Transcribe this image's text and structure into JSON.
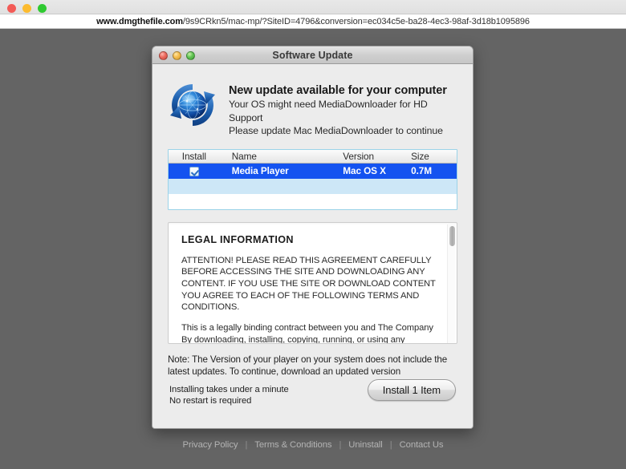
{
  "browser": {
    "traffic_lights": [
      {
        "name": "close",
        "color": "#f35b57"
      },
      {
        "name": "minimize",
        "color": "#fcbb2f"
      },
      {
        "name": "zoom",
        "color": "#2fc931"
      }
    ],
    "url_domain": "www.dmgthefile.com",
    "url_path": "/9s9CRkn5/mac-mp/?SiteID=4796&conversion=ec034c5e-ba28-4ec3-98af-3d18b1095896",
    "url_full": "www.dmgthefile.com/9s9CRkn5/mac-mp/?SiteID=4796&conversion=ec034c5e-ba28-4ec3-98af-3d18b1095896"
  },
  "dialog": {
    "title": "Software Update",
    "traffic_lights": [
      {
        "name": "close",
        "color": "#ec6a5e"
      },
      {
        "name": "minimize",
        "color": "#f5bd4f"
      },
      {
        "name": "zoom",
        "color": "#61c554"
      }
    ],
    "header": {
      "icon": "software-update-globe-icon",
      "title": "New update available for your computer",
      "line1": "Your OS might need MediaDownloader for HD Support",
      "line2": "Please update Mac MediaDownloader to continue"
    },
    "table": {
      "columns": [
        "Install",
        "Name",
        "Version",
        "Size"
      ],
      "rows": [
        {
          "install_checked": true,
          "name": "Media Player",
          "version": "Mac OS X",
          "size": "0.7M",
          "selected": true
        }
      ]
    },
    "legal": {
      "heading": "LEGAL INFORMATION",
      "paragraph1": "ATTENTION! PLEASE READ THIS AGREEMENT CAREFULLY BEFORE ACCESSING THE SITE AND DOWNLOADING ANY CONTENT. IF YOU USE THE SITE OR DOWNLOAD CONTENT YOU AGREE TO EACH OF THE FOLLOWING TERMS AND CONDITIONS.",
      "paragraph2": "This is a legally binding contract between you and The Company By downloading, installing, copying, running, or using any content of dmgthefile.com, you are agreeing to be bound by the terms of this"
    },
    "note": "Note: The Version of your player on your system does not include the latest updates. To continue, download an updated version",
    "install_info_line1": "Installing takes under a minute",
    "install_info_line2": "No restart is required",
    "install_button": "Install 1 Item"
  },
  "page_footer": {
    "links": [
      "Privacy Policy",
      "Terms & Conditions",
      "Uninstall",
      "Contact Us"
    ],
    "separator": "|"
  },
  "colors": {
    "page_background": "#646464",
    "dialog_background": "#ececec",
    "selection_blue": "#1453f0",
    "alt_row_blue": "#cde7f7",
    "table_focus_border": "#9bd3e8",
    "footer_link": "#b3b3b3"
  }
}
